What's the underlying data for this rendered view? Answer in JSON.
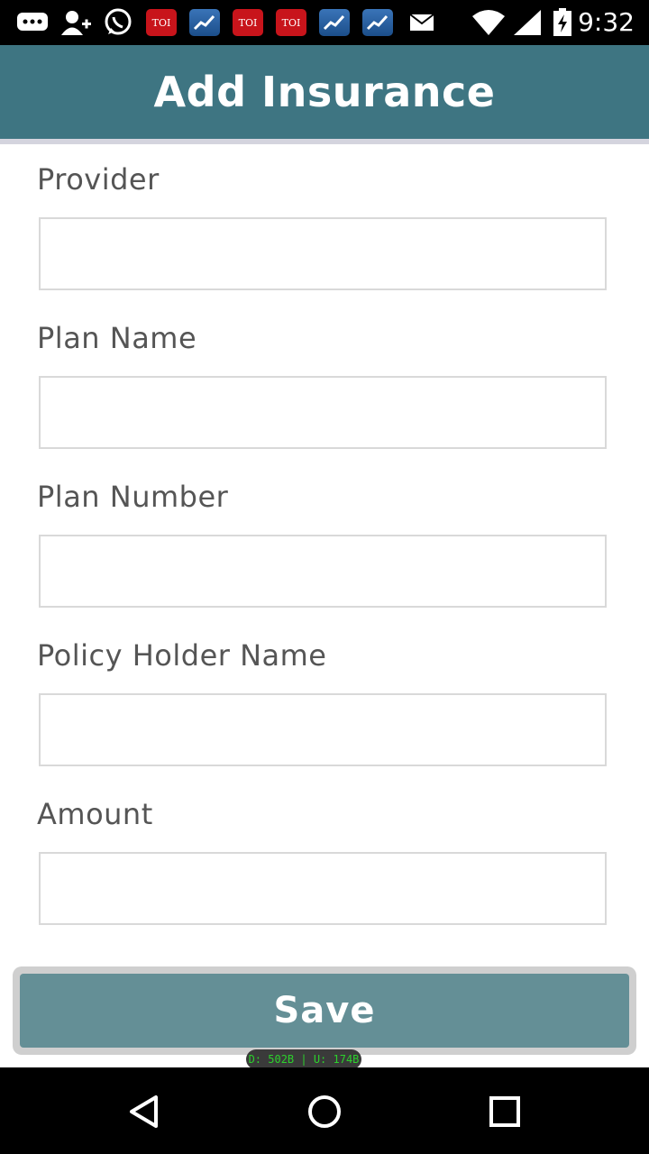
{
  "status_bar": {
    "time": "9:32",
    "notification_icons": [
      "message-icon",
      "add-contact-icon",
      "whatsapp-icon",
      "toi-icon",
      "chart-app-icon",
      "toi-icon",
      "toi-icon",
      "chart-app-icon",
      "chart-app-icon",
      "mail-icon"
    ],
    "toi_label": "TOI"
  },
  "header": {
    "title": "Add Insurance"
  },
  "form": {
    "provider": {
      "label": "Provider",
      "value": ""
    },
    "plan_name": {
      "label": "Plan Name",
      "value": ""
    },
    "plan_number": {
      "label": "Plan Number",
      "value": ""
    },
    "policy_holder_name": {
      "label": "Policy Holder Name",
      "value": ""
    },
    "amount": {
      "label": "Amount",
      "value": ""
    }
  },
  "save_label": "Save",
  "traffic_overlay": "D: 502B  |  U: 174B",
  "nav": {
    "back": "back-icon",
    "home": "home-icon",
    "recents": "recents-icon"
  },
  "colors": {
    "header": "#3e7582",
    "button": "#648f96"
  }
}
